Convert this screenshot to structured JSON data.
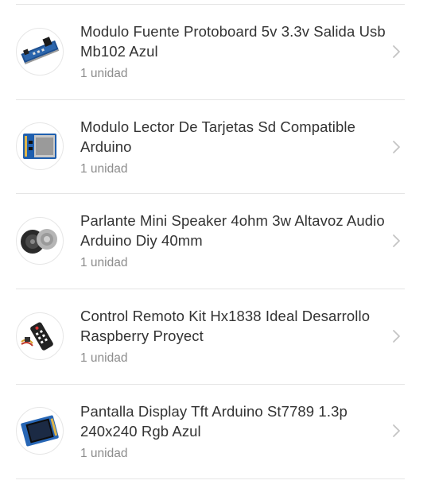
{
  "colors": {
    "text_primary": "#333333",
    "text_secondary": "#8c8c8c",
    "divider": "#e5e5e5",
    "chevron": "#c4c4c4"
  },
  "items": [
    {
      "title": "Modulo Fuente Protoboard 5v 3.3v Salida Usb Mb102 Azul",
      "quantity": "1 unidad",
      "icon": "power-module-icon"
    },
    {
      "title": "Modulo Lector De Tarjetas Sd Compatible Arduino",
      "quantity": "1 unidad",
      "icon": "sd-card-module-icon"
    },
    {
      "title": "Parlante Mini Speaker 4ohm 3w Altavoz Audio Arduino Diy 40mm",
      "quantity": "1 unidad",
      "icon": "speaker-icon"
    },
    {
      "title": "Control Remoto Kit Hx1838 Ideal Desarrollo Raspberry Proyect",
      "quantity": "1 unidad",
      "icon": "remote-control-kit-icon"
    },
    {
      "title": "Pantalla Display Tft Arduino St7789 1.3p 240x240 Rgb Azul",
      "quantity": "1 unidad",
      "icon": "tft-display-icon"
    }
  ]
}
